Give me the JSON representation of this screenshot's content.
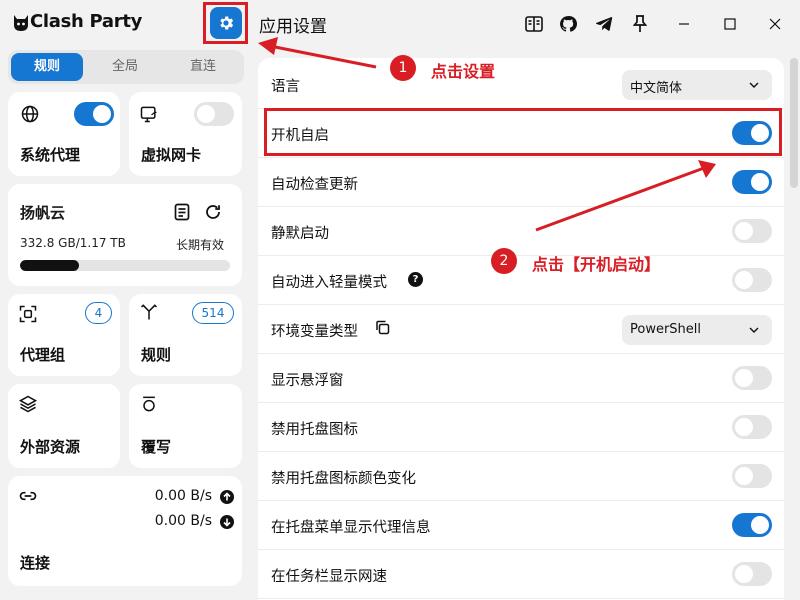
{
  "app": {
    "title": "Clash Party",
    "logo_icon": "cat-icon",
    "settings_icon": "gear-icon"
  },
  "mode_tabs": [
    {
      "label": "规则",
      "active": true
    },
    {
      "label": "全局",
      "active": false
    },
    {
      "label": "直连",
      "active": false
    }
  ],
  "quick_cards": {
    "system_proxy": {
      "label": "系统代理",
      "icon": "globe-icon",
      "enabled": true
    },
    "tun": {
      "label": "虚拟网卡",
      "icon": "network-card-icon",
      "enabled": false
    }
  },
  "profile": {
    "name": "扬帆云",
    "usage": "332.8 GB/1.17 TB",
    "expire": "长期有效",
    "usage_fraction": 0.28
  },
  "nav_cards": {
    "proxy_groups": {
      "label": "代理组",
      "count": "4",
      "icon": "scan-icon"
    },
    "rules": {
      "label": "规则",
      "count": "514",
      "icon": "fork-icon"
    },
    "resources": {
      "label": "外部资源",
      "icon": "layers-icon"
    },
    "override": {
      "label": "覆写",
      "icon": "override-icon"
    }
  },
  "connections": {
    "label": "连接",
    "upload": "0.00 B/s",
    "download": "0.00 B/s"
  },
  "main": {
    "title": "应用设置",
    "window_controls": [
      "book-icon",
      "github-icon",
      "telegram-icon",
      "pin-icon",
      "minimize-icon",
      "maximize-icon",
      "close-icon"
    ]
  },
  "settings": [
    {
      "label": "语言",
      "type": "select",
      "value": "中文简体"
    },
    {
      "label": "开机自启",
      "type": "toggle",
      "enabled": true
    },
    {
      "label": "自动检查更新",
      "type": "toggle",
      "enabled": true
    },
    {
      "label": "静默启动",
      "type": "toggle",
      "enabled": false
    },
    {
      "label": "自动进入轻量模式",
      "type": "toggle",
      "enabled": false,
      "help": "?"
    },
    {
      "label": "环境变量类型",
      "type": "select",
      "value": "PowerShell",
      "copy_icon": true
    },
    {
      "label": "显示悬浮窗",
      "type": "toggle",
      "enabled": false
    },
    {
      "label": "禁用托盘图标",
      "type": "toggle",
      "enabled": false
    },
    {
      "label": "禁用托盘图标颜色变化",
      "type": "toggle",
      "enabled": false
    },
    {
      "label": "在托盘菜单显示代理信息",
      "type": "toggle",
      "enabled": true
    },
    {
      "label": "在任务栏显示网速",
      "type": "toggle",
      "enabled": false
    }
  ],
  "annotations": {
    "step1": {
      "num": "1",
      "text": "点击设置"
    },
    "step2": {
      "num": "2",
      "text": "点击【开机启动】"
    }
  },
  "colors": {
    "accent": "#1677d2",
    "annotation": "#d81e24"
  }
}
